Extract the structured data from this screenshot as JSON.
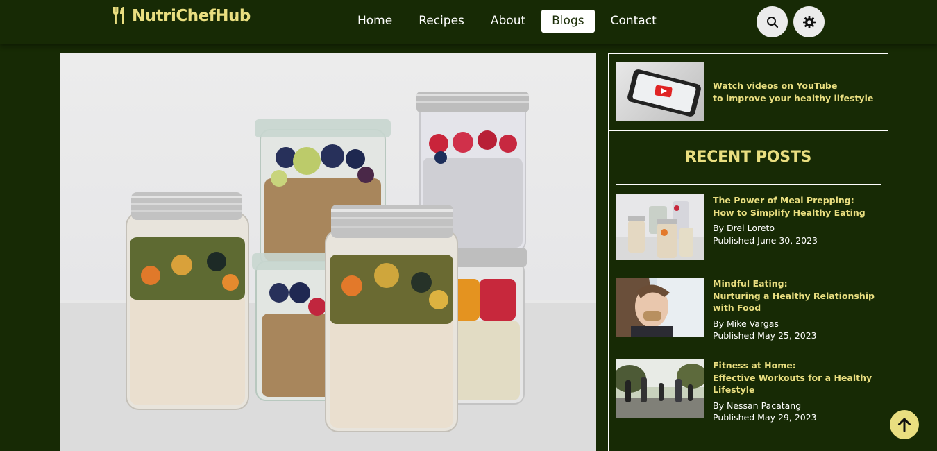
{
  "brand": {
    "name": "NutriChefHub",
    "color": "#e9de80"
  },
  "nav": {
    "links": [
      {
        "label": "Home",
        "active": false
      },
      {
        "label": "Recipes",
        "active": false
      },
      {
        "label": "About",
        "active": false
      },
      {
        "label": "Blogs",
        "active": true
      },
      {
        "label": "Contact",
        "active": false
      }
    ],
    "icons": [
      "search-icon",
      "gear-icon"
    ]
  },
  "hero": {
    "alt_icon": "meal-prep-jars-image"
  },
  "sidebar": {
    "youtube": {
      "line1": "Watch videos on YouTube",
      "line2": "to improve your healthy lifestyle"
    },
    "recent_title": "RECENT POSTS",
    "posts": [
      {
        "title": "The Power of Meal Prepping:\nHow to Simplify Healthy Eating",
        "author": "By Drei Loreto",
        "published": "Published June 30, 2023"
      },
      {
        "title": "Mindful Eating:\nNurturing a Healthy Relationship with Food",
        "author": "By Mike Vargas",
        "published": "Published May 25, 2023"
      },
      {
        "title": "Fitness at Home:\nEffective Workouts for a Healthy Lifestyle",
        "author": "By Nessan Pacatang",
        "published": "Published May 29, 2023"
      }
    ]
  },
  "colors": {
    "background": "#172a05",
    "accent": "#e9de80",
    "text": "#ffffff"
  },
  "back_to_top_icon": "arrow-up-icon"
}
